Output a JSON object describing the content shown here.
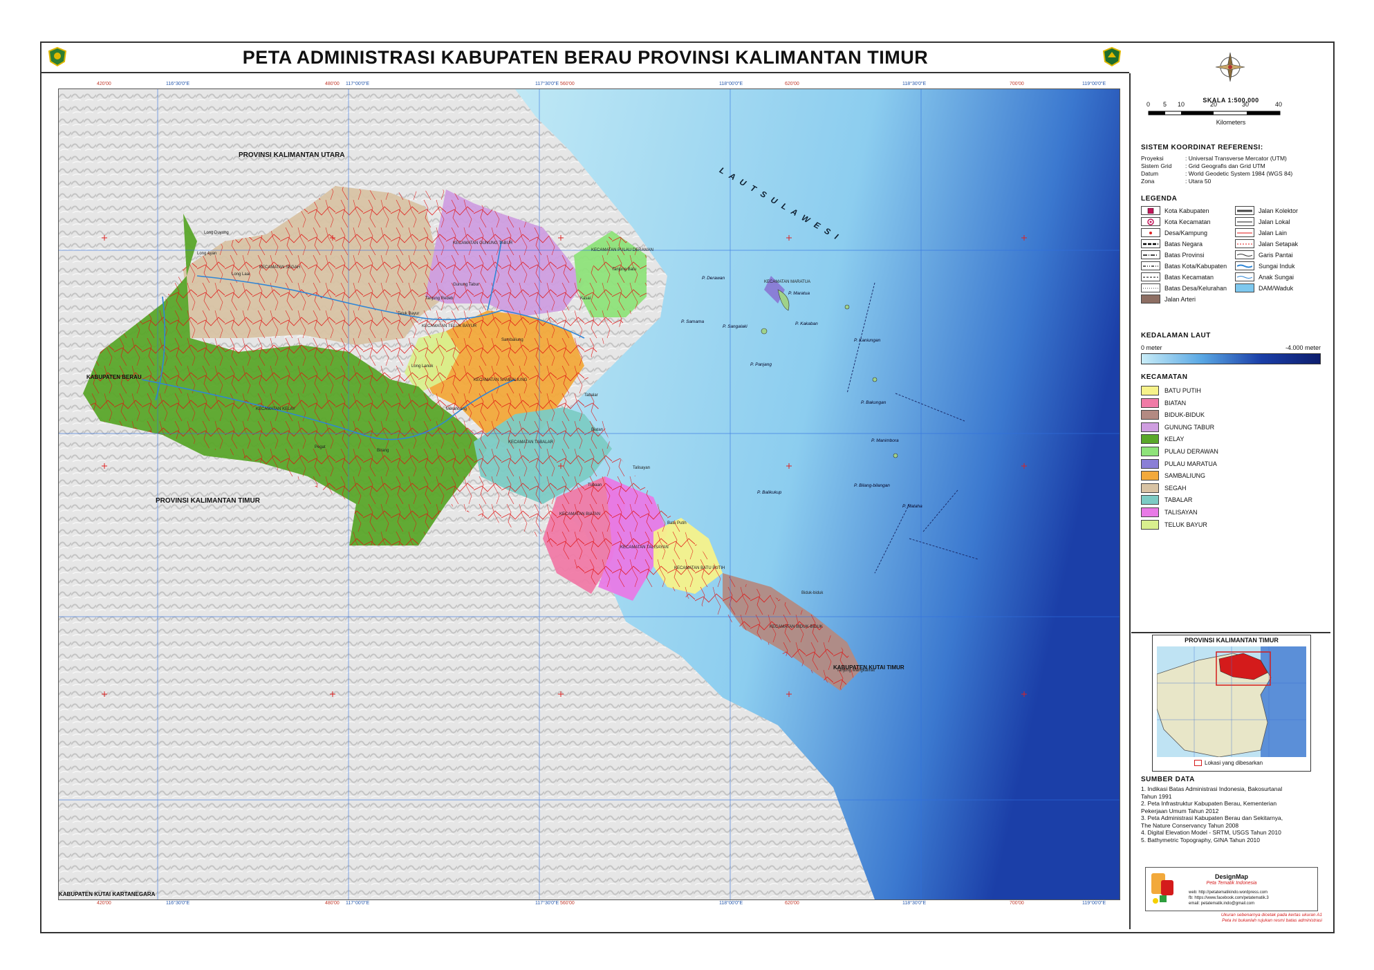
{
  "title": "PETA ADMINISTRASI KABUPATEN BERAU PROVINSI KALIMANTAN TIMUR",
  "map": {
    "grid_top_labels": [
      "420'00",
      "116°30'0\"E",
      "480'00",
      "117°00'0\"E",
      "117°30'0\"E",
      "560'00",
      "118°00'0\"E",
      "620'00",
      "118°30'0\"E",
      "700'00",
      "119°00'0\"E"
    ],
    "grid_bottom_labels": [
      "420'00",
      "116°30'0\"E",
      "480'00",
      "117°00'0\"E",
      "117°30'0\"E",
      "560'00",
      "118°00'0\"E",
      "620'00",
      "118°30'0\"E",
      "700'00",
      "119°00'0\"E"
    ],
    "region_labels": {
      "kaltara": "PROVINSI KALIMANTAN UTARA",
      "kaltim": "PROVINSI KALIMANTAN TIMUR",
      "berau": "KABUPATEN BERAU",
      "kutai_timur": "KABUPATEN KUTAI TIMUR",
      "kutai_kartanegara": "KABUPATEN KUTAI KARTANEGARA",
      "sea": "L A U T   S U L A W E S I"
    },
    "district_labels": [
      "KECAMATAN SEGAH",
      "KECAMATAN GUNUNG TABUR",
      "KECAMATAN PULAU DERAWAN",
      "KECAMATAN SAMBALIUNG",
      "KECAMATAN TELUK BAYUR",
      "KECAMATAN KELAY",
      "KECAMATAN TABALAR",
      "KECAMATAN BIATAN",
      "KECAMATAN TALISAYAN",
      "KECAMATAN BATU PUTIH",
      "KECAMATAN BIDUK-BIDUK",
      "KECAMATAN MARATUA"
    ],
    "places": [
      "Long Duyung",
      "Long Laai",
      "Long Ayan",
      "Tanjung Batu",
      "Kasai",
      "Gunung Tabur",
      "Tanjung Redeb",
      "Teluk Bayur",
      "Long Lanuk",
      "Tabalar",
      "Biatan",
      "Talisayan",
      "Batu Putih",
      "Biduk-biduk",
      "Tanjung Mangkalihat",
      "Tubaan",
      "Merancang",
      "Sambaliung",
      "Pegat",
      "Birang"
    ],
    "islands": [
      "P. Maratua",
      "P. Kakaban",
      "P. Sangalaki",
      "P. Derawan",
      "P. Samama",
      "P. Panjang",
      "P. Bakungan",
      "P. Mataha",
      "P. Kaniungan",
      "P. Balikukup",
      "P. Bilang-bilangan",
      "P. Manimbora"
    ]
  },
  "panel": {
    "scale_title": "SKALA  1:500,000",
    "scale_ticks": [
      "0",
      "5",
      "10",
      "20",
      "30",
      "40"
    ],
    "scale_unit": "Kilometers",
    "crs_title": "SISTEM KOORDINAT REFERENSI:",
    "crs": [
      {
        "k": "Proyeksi",
        "v": ": Universal Transverse Mercator (UTM)"
      },
      {
        "k": "Sistem Grid",
        "v": ": Grid Geografis dan Grid UTM"
      },
      {
        "k": "Datum",
        "v": ": World Geodetic System 1984 (WGS 84)"
      },
      {
        "k": "Zona",
        "v": ": Utara 50"
      }
    ],
    "legend_title": "LEGENDA",
    "legend_left": [
      "Kota Kabupaten",
      "Kota Kecamatan",
      "Desa/Kampung",
      "Batas Negara",
      "Batas Provinsi",
      "Batas Kota/Kabupaten",
      "Batas Kecamatan",
      "Batas Desa/Kelurahan",
      "Jalan Arteri"
    ],
    "legend_right": [
      "Jalan Kolektor",
      "Jalan Lokal",
      "Jalan Lain",
      "Jalan Setapak",
      "Garis Pantai",
      "Sungai Induk",
      "Anak Sungai",
      "DAM/Waduk"
    ],
    "depth_title": "KEDALAMAN LAUT",
    "depth_min": "0 meter",
    "depth_max": "-4.000 meter",
    "kecamatan_title": "KECAMATAN",
    "kecamatan": [
      {
        "name": "BATU PUTIH",
        "color": "#f6f28a"
      },
      {
        "name": "BIATAN",
        "color": "#f07aa6"
      },
      {
        "name": "BIDUK-BIDUK",
        "color": "#b38a82"
      },
      {
        "name": "GUNUNG TABUR",
        "color": "#cf9ee0"
      },
      {
        "name": "KELAY",
        "color": "#5aa72a"
      },
      {
        "name": "PULAU DERAWAN",
        "color": "#8ee37a"
      },
      {
        "name": "PULAU MARATUA",
        "color": "#8a7fd6"
      },
      {
        "name": "SAMBALIUNG",
        "color": "#f2a93b"
      },
      {
        "name": "SEGAH",
        "color": "#d8c3a4"
      },
      {
        "name": "TABALAR",
        "color": "#7ccbc4"
      },
      {
        "name": "TALISAYAN",
        "color": "#e87ae6"
      },
      {
        "name": "TELUK BAYUR",
        "color": "#d9f08e"
      }
    ],
    "inset_title": "PROVINSI KALIMANTAN TIMUR",
    "inset_legend": "Lokasi yang dibesarkan",
    "sources_title": "SUMBER DATA",
    "sources": [
      "1. Indikasi Batas Administrasi Indonesia, Bakosurtanal",
      "    Tahun 1991",
      "2. Peta Infrastruktur Kabupaten Berau, Kementerian",
      "    Pekerjaan Umum Tahun 2012",
      "3. Peta Administrasi Kabupaten Berau dan Sekitarnya,",
      "    The Nature Conservancy Tahun 2008",
      "4. Digital Elevation Model - SRTM, USGS Tahun 2010",
      "5. Bathymetric Topography, GINA Tahun 2010"
    ],
    "designer": "DesignMap",
    "designer_sub": "Peta Tematik Indonesia",
    "contacts": [
      "web: http://petatematikindo.wordpress.com",
      "fb: https://www.facebook.com/petatematik.3",
      "email: petatematik.indo@gmail.com"
    ],
    "disclaimer1": "Ukuran sebenarnya dicetak pada kertas ukuran A1",
    "disclaimer2": "Peta ini bukanlah rujukan resmi batas administrasi"
  },
  "colors": {
    "sea_shallow": "#c8ecf7",
    "sea_deep": "#1b3fa8",
    "grid": "#2f6fe0",
    "road": "#e01010"
  }
}
